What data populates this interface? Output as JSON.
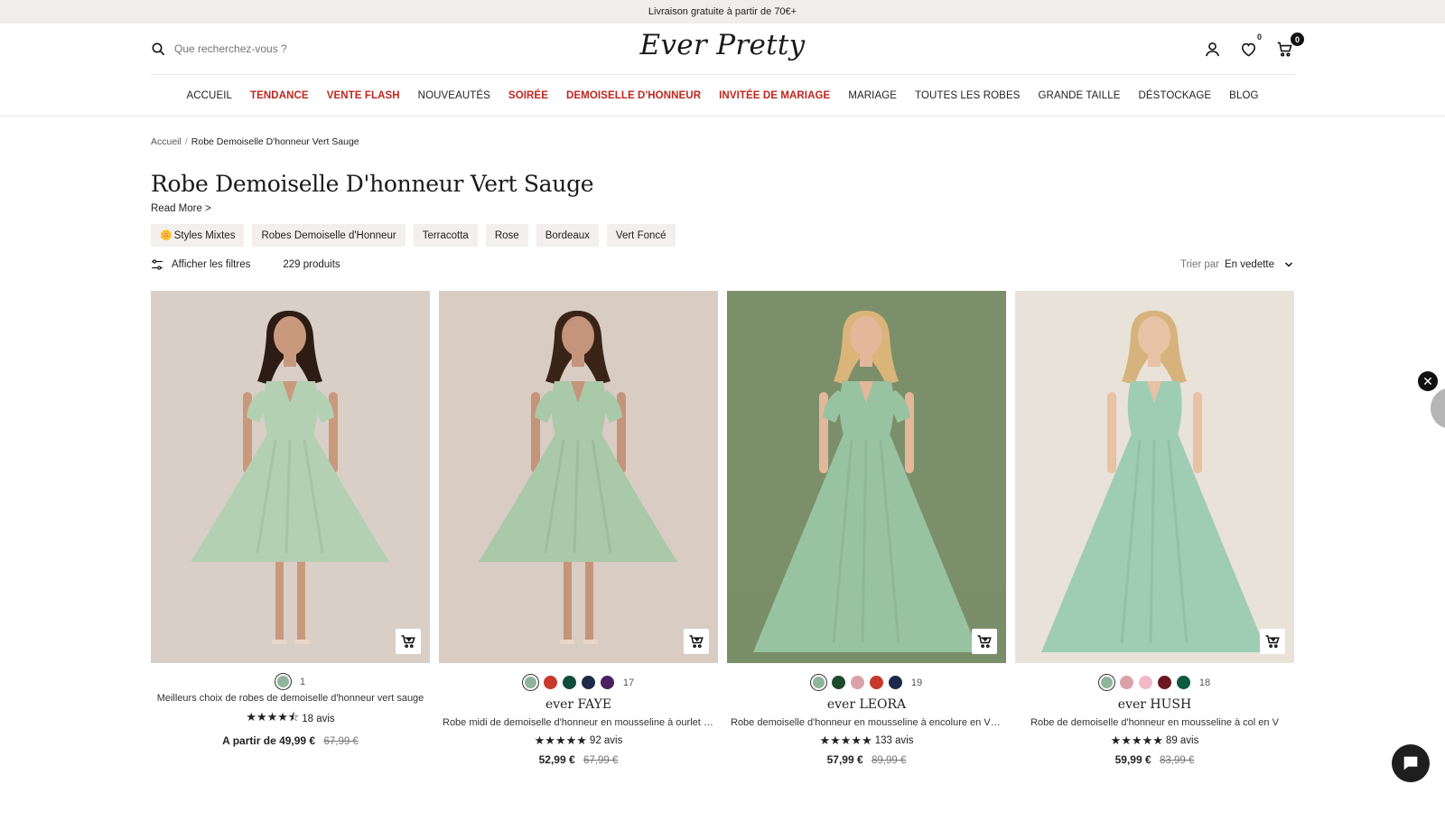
{
  "announcement": "Livraison gratuite à partir de 70€+",
  "header": {
    "search_placeholder": "Que recherchez-vous ?",
    "logo": "Ever Pretty",
    "wishlist_count": "0",
    "cart_count": "0"
  },
  "nav": [
    {
      "label": "ACCUEIL",
      "highlight": false
    },
    {
      "label": "TENDANCE",
      "highlight": true
    },
    {
      "label": "VENTE FLASH",
      "highlight": true
    },
    {
      "label": "NOUVEAUTÉS",
      "highlight": false
    },
    {
      "label": "SOIRÉE",
      "highlight": true
    },
    {
      "label": "DEMOISELLE D'HONNEUR",
      "highlight": true
    },
    {
      "label": "INVITÉE DE MARIAGE",
      "highlight": true
    },
    {
      "label": "MARIAGE",
      "highlight": false
    },
    {
      "label": "TOUTES LES ROBES",
      "highlight": false
    },
    {
      "label": "GRANDE TAILLE",
      "highlight": false
    },
    {
      "label": "DÉSTOCKAGE",
      "highlight": false
    },
    {
      "label": "BLOG",
      "highlight": false
    }
  ],
  "breadcrumb": {
    "home": "Accueil",
    "sep": "/",
    "current": "Robe Demoiselle D'honneur Vert Sauge"
  },
  "page": {
    "title": "Robe Demoiselle D'honneur Vert Sauge",
    "read_more": "Read More >"
  },
  "tags": [
    "Styles Mixtes",
    "Robes Demoiselle d'Honneur",
    "Terracotta",
    "Rose",
    "Bordeaux",
    "Vert Foncé"
  ],
  "toolbar": {
    "filters": "Afficher les filtres",
    "count": "229 produits",
    "sort_label": "Trier par",
    "sort_value": "En vedette"
  },
  "colors": {
    "accent_red": "#c0271e",
    "sage": "#9fc3a6"
  },
  "products": [
    {
      "swatches": [
        "#8fb59a"
      ],
      "swatch_count": "1",
      "brand": "",
      "description": "Meilleurs choix de robes de demoiselle d'honneur vert sauge",
      "stars": "★★★★⯪",
      "reviews": "18 avis",
      "price": "A partir de 49,99 €",
      "old_price": "67,99 €",
      "bg": "#d9cfc7",
      "dress": "#b3d0b2",
      "skin": "#c9997e",
      "hair": "#2c1c14",
      "length": "midi",
      "sleeve": true
    },
    {
      "swatches": [
        "#8fb59a",
        "#c8392b",
        "#114d3a",
        "#1d2a4a",
        "#4a2060"
      ],
      "swatch_count": "17",
      "brand": "ever FAYE",
      "description": "Robe midi de demoiselle d'honneur en mousseline à ourlet hau...",
      "stars": "★★★★★",
      "reviews": "92 avis",
      "price": "52,99 €",
      "old_price": "67,99 €",
      "bg": "#d8ccc3",
      "dress": "#a9c9a8",
      "skin": "#c4957a",
      "hair": "#3a2418",
      "length": "midi",
      "sleeve": true
    },
    {
      "swatches": [
        "#8fb59a",
        "#1d4a2e",
        "#d9a1a8",
        "#c8392b",
        "#1d2a4a"
      ],
      "swatch_count": "19",
      "brand": "ever LEORA",
      "description": "Robe demoiselle d'honneur en mousseline à encolure en V et à...",
      "stars": "★★★★★",
      "reviews": "133 avis",
      "price": "57,99 €",
      "old_price": "89,99 €",
      "bg": "#7b8f6a",
      "dress": "#98c3a0",
      "skin": "#e2b79a",
      "hair": "#d9b57a",
      "length": "long",
      "sleeve": true
    },
    {
      "swatches": [
        "#8fb59a",
        "#d9a1a8",
        "#f2b8c6",
        "#6b1620",
        "#0e5a3e"
      ],
      "swatch_count": "18",
      "brand": "ever HUSH",
      "description": "Robe de demoiselle d'honneur en mousseline à col en V",
      "stars": "★★★★★",
      "reviews": "89 avis",
      "price": "59,99 €",
      "old_price": "83,99 €",
      "bg": "#e8e2d8",
      "dress": "#9ecdb3",
      "skin": "#e8c2a4",
      "hair": "#d6b37c",
      "length": "long",
      "sleeve": false
    }
  ]
}
